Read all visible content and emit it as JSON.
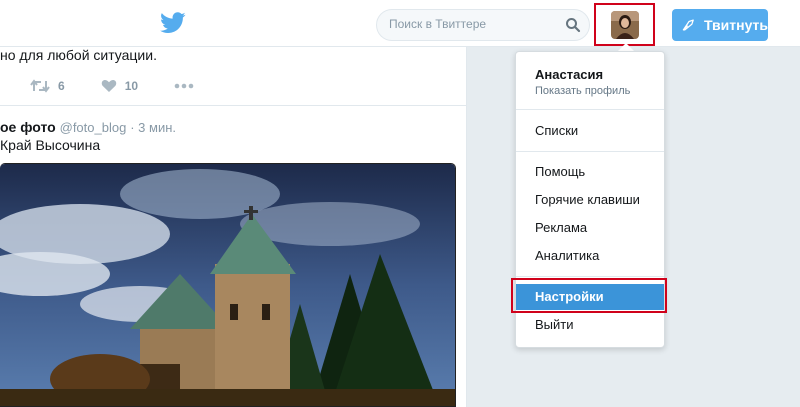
{
  "header": {
    "search_placeholder": "Поиск в Твиттере",
    "tweet_button_label": "Твитнуть"
  },
  "timeline": {
    "tweet1": {
      "text": "но для любой ситуации.",
      "retweets": "6",
      "likes": "10"
    },
    "tweet2": {
      "author": "ое фото",
      "handle": "@foto_blog",
      "time": "· 3 мин.",
      "text": "Край Высочина"
    }
  },
  "menu": {
    "user_name": "Анастасия",
    "show_profile": "Показать профиль",
    "items": [
      {
        "label": "Списки"
      },
      {
        "label": "Помощь"
      },
      {
        "label": "Горячие клавиши"
      },
      {
        "label": "Реклама"
      },
      {
        "label": "Аналитика"
      },
      {
        "label": "Настройки"
      },
      {
        "label": "Выйти"
      }
    ]
  },
  "colors": {
    "accent": "#55acee",
    "highlight": "#3b94d9",
    "annotation": "#d0021b"
  }
}
